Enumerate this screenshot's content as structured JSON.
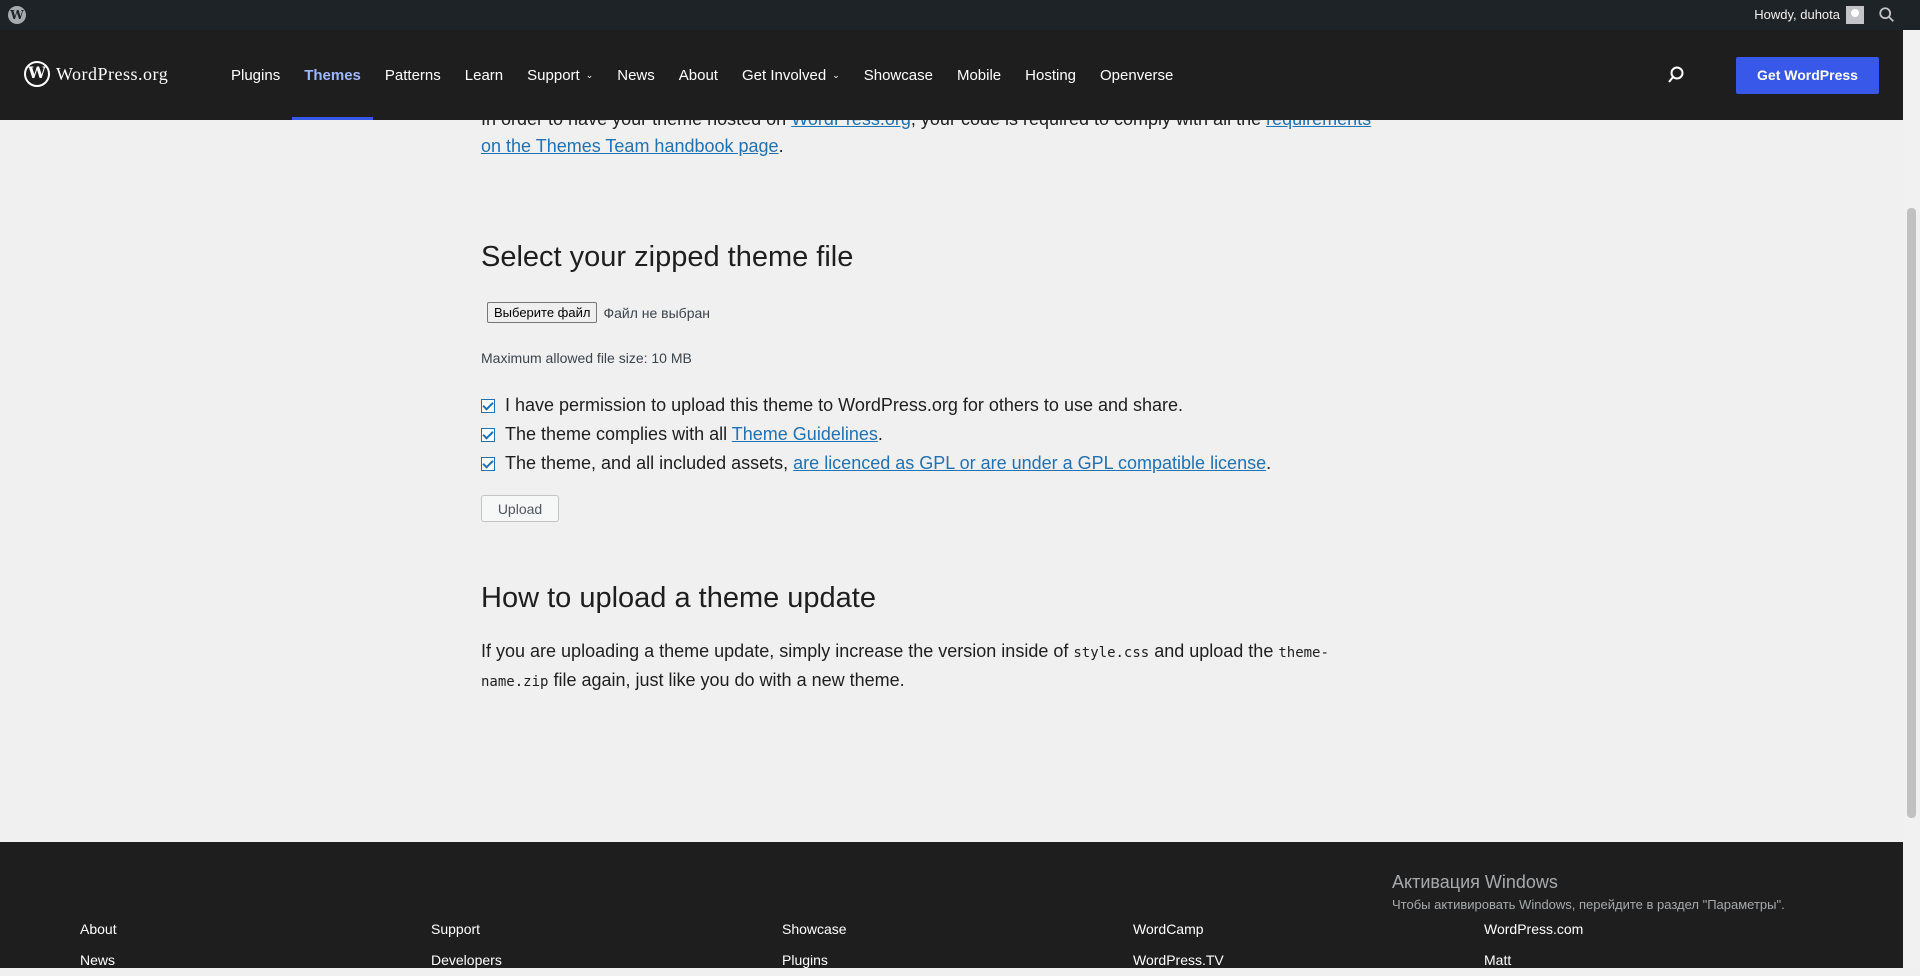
{
  "admin_bar": {
    "greeting": "Howdy, duhota"
  },
  "header": {
    "logo_text": "WordPress.org",
    "nav": [
      {
        "label": "Plugins"
      },
      {
        "label": "Themes"
      },
      {
        "label": "Patterns"
      },
      {
        "label": "Learn"
      },
      {
        "label": "Support"
      },
      {
        "label": "News"
      },
      {
        "label": "About"
      },
      {
        "label": "Get Involved"
      },
      {
        "label": "Showcase"
      },
      {
        "label": "Mobile"
      },
      {
        "label": "Hosting"
      },
      {
        "label": "Openverse"
      }
    ],
    "cta": "Get WordPress"
  },
  "main": {
    "intro": {
      "pre": "In order to have your theme hosted on ",
      "link1": "WordPress.org",
      "mid": ", your code is required to comply with all the ",
      "link2": "require­ments on the Themes Team handbook page",
      "post": "."
    },
    "select_heading": "Select your zipped theme file",
    "file_button": "Выберите файл",
    "file_status": "Файл не выбран",
    "max_size": "Maximum allowed file size: 10 MB",
    "checks": {
      "c1": "I have permission to upload this theme to WordPress.org for others to use and share.",
      "c2_pre": "The theme complies with all ",
      "c2_link": "Theme Guidelines",
      "c2_post": ".",
      "c3_pre": "The theme, and all included assets, ",
      "c3_link": "are licenced as GPL or are under a GPL compatible license",
      "c3_post": "."
    },
    "upload_button": "Upload",
    "update_heading": "How to upload a theme update",
    "update_text": {
      "pre": "If you are uploading a theme update, simply increase the version inside of ",
      "code1": "style.css",
      "mid": " and upload the ",
      "code2": "theme-name.zip",
      "post": " file again, just like you do with a new theme."
    }
  },
  "footer": {
    "col1": [
      "About",
      "News"
    ],
    "col2": [
      "Support",
      "Developers"
    ],
    "col3": [
      "Showcase",
      "Plugins"
    ],
    "col4": [
      "WordCamp",
      "WordPress.TV"
    ],
    "col5": [
      "WordPress.com",
      "Matt"
    ]
  },
  "watermark": {
    "title": "Активация Windows",
    "subtitle": "Чтобы активировать Windows, перейдите в раздел \"Параметры\"."
  }
}
